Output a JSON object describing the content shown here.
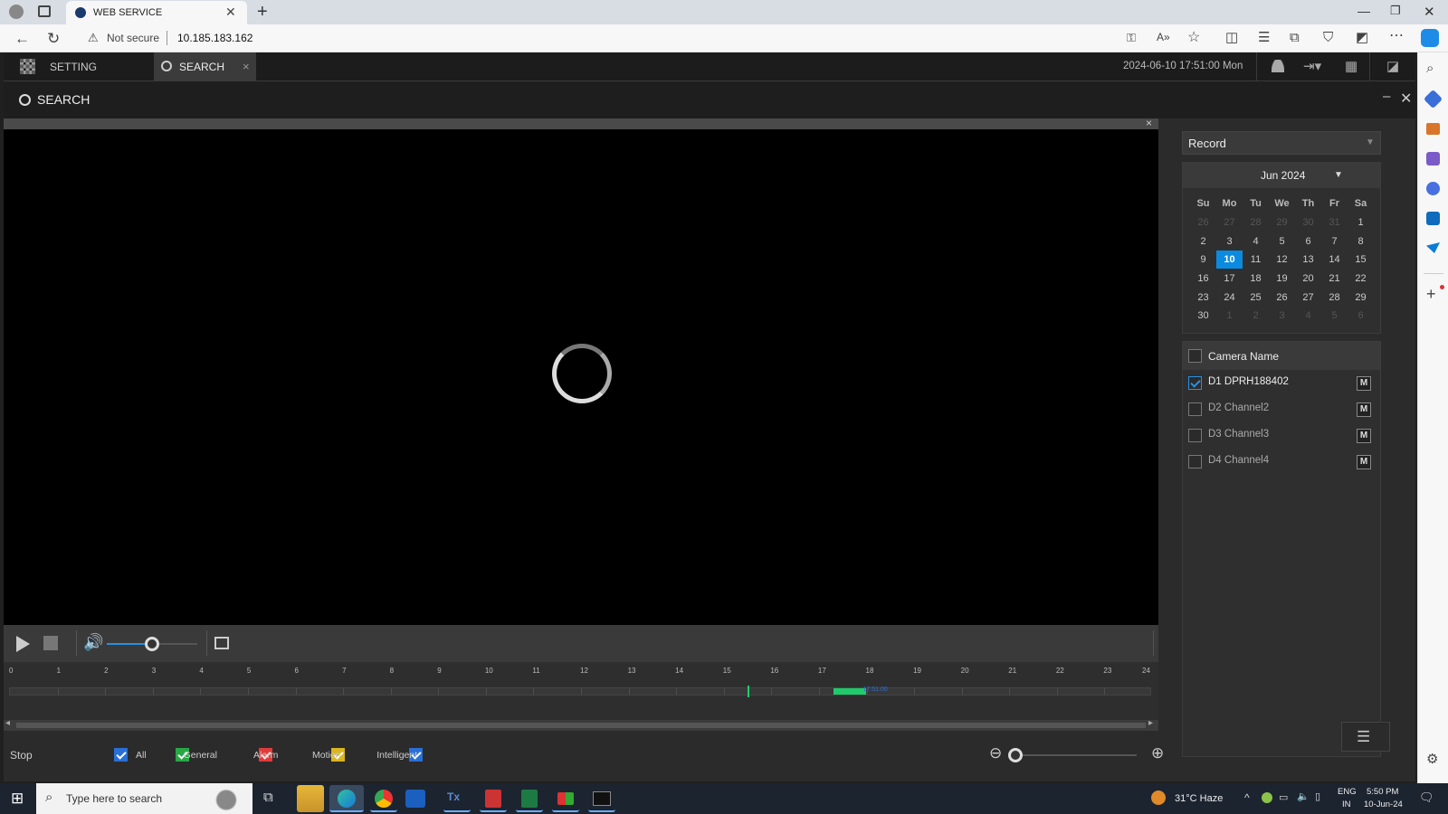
{
  "browser": {
    "tab_title": "WEB SERVICE",
    "security": "Not secure",
    "url": "10.185.183.162"
  },
  "app": {
    "nav": {
      "setting": "SETTING",
      "search": "SEARCH",
      "close": "×"
    },
    "datetime": "2024-06-10 17:51:00 Mon",
    "panel_title": "SEARCH",
    "video_close": "×"
  },
  "controls": {
    "volume": 0.5
  },
  "timeline": {
    "hours": [
      "0",
      "1",
      "2",
      "3",
      "4",
      "5",
      "6",
      "7",
      "8",
      "9",
      "10",
      "11",
      "12",
      "13",
      "14",
      "15",
      "16",
      "17",
      "18",
      "19",
      "20",
      "21",
      "22",
      "23",
      "24"
    ],
    "marker_label": "17:51:00",
    "recording_segments": [
      {
        "start_hour": 17.3,
        "end_hour": 18.0
      }
    ],
    "cursor_hour": 15.5
  },
  "footer": {
    "stop_label": "Stop",
    "filters": [
      {
        "label": "All",
        "color": "#2a6fd6",
        "checked": true
      },
      {
        "label": "General",
        "color": "#27a845",
        "checked": true
      },
      {
        "label": "Alarm",
        "color": "#e03b3b",
        "checked": true
      },
      {
        "label": "Motion",
        "color": "#d9b51f",
        "checked": true
      },
      {
        "label": "Intelligent",
        "color": "#2a6fd6",
        "checked": true
      }
    ],
    "zoom": 0
  },
  "right": {
    "record_type": "Record",
    "month": "Jun 2024",
    "weekdays": [
      "Su",
      "Mo",
      "Tu",
      "We",
      "Th",
      "Fr",
      "Sa"
    ],
    "weeks": [
      [
        "26",
        "27",
        "28",
        "29",
        "30",
        "31",
        "1"
      ],
      [
        "2",
        "3",
        "4",
        "5",
        "6",
        "7",
        "8"
      ],
      [
        "9",
        "10",
        "11",
        "12",
        "13",
        "14",
        "15"
      ],
      [
        "16",
        "17",
        "18",
        "19",
        "20",
        "21",
        "22"
      ],
      [
        "23",
        "24",
        "25",
        "26",
        "27",
        "28",
        "29"
      ],
      [
        "30",
        "1",
        "2",
        "3",
        "4",
        "5",
        "6"
      ]
    ],
    "selected_day": "10",
    "camera_header": "Camera Name",
    "cameras": [
      {
        "name": "D1 DPRH188402",
        "checked": true,
        "mode": "M"
      },
      {
        "name": "D2 Channel2",
        "checked": false,
        "mode": "M"
      },
      {
        "name": "D3 Channel3",
        "checked": false,
        "mode": "M"
      },
      {
        "name": "D4 Channel4",
        "checked": false,
        "mode": "M"
      }
    ]
  },
  "taskbar": {
    "search_placeholder": "Type here to search",
    "weather": "31°C  Haze",
    "lang": "ENG",
    "region": "IN",
    "time": "5:50 PM",
    "date": "10-Jun-24"
  }
}
